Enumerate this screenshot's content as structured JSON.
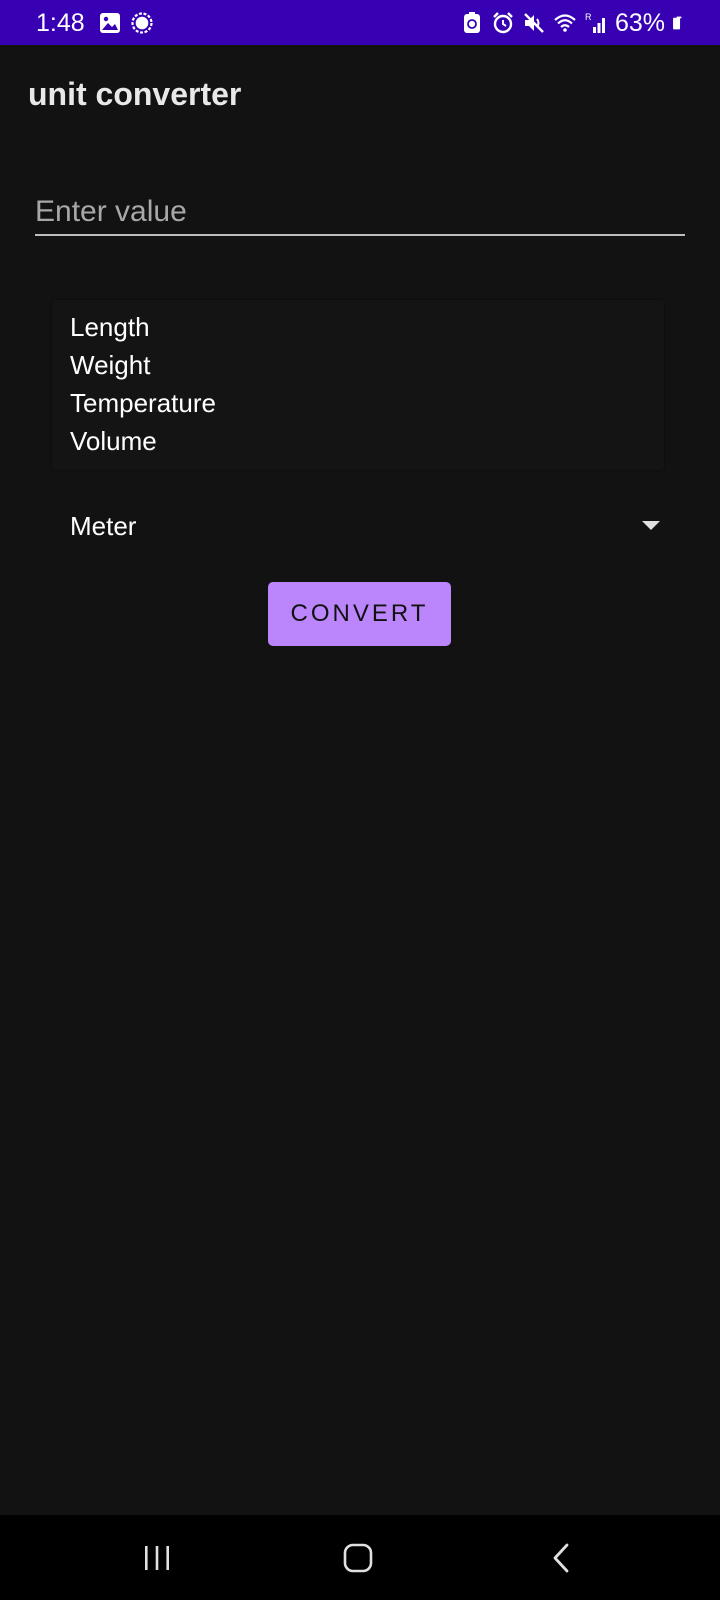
{
  "status_bar": {
    "time": "1:48",
    "battery_percent": "63%",
    "left_icons": [
      "gallery-icon",
      "messenger-icon"
    ],
    "right_icons": [
      "sync-icon",
      "alarm-icon",
      "mute-icon",
      "wifi-icon",
      "signal-icon",
      "battery-icon"
    ],
    "background_color": "#3700b3"
  },
  "app": {
    "title": "unit converter"
  },
  "input": {
    "value": "",
    "placeholder": "Enter value"
  },
  "categories": {
    "items": [
      "Length",
      "Weight",
      "Temperature",
      "Volume"
    ]
  },
  "unit_spinner": {
    "selected": "Meter",
    "icon": "dropdown-arrow-icon"
  },
  "convert_button": {
    "label": "CONVERT",
    "color": "#bb86fc"
  },
  "nav_bar": {
    "icons": [
      "recent-apps-icon",
      "home-icon",
      "back-icon"
    ]
  }
}
